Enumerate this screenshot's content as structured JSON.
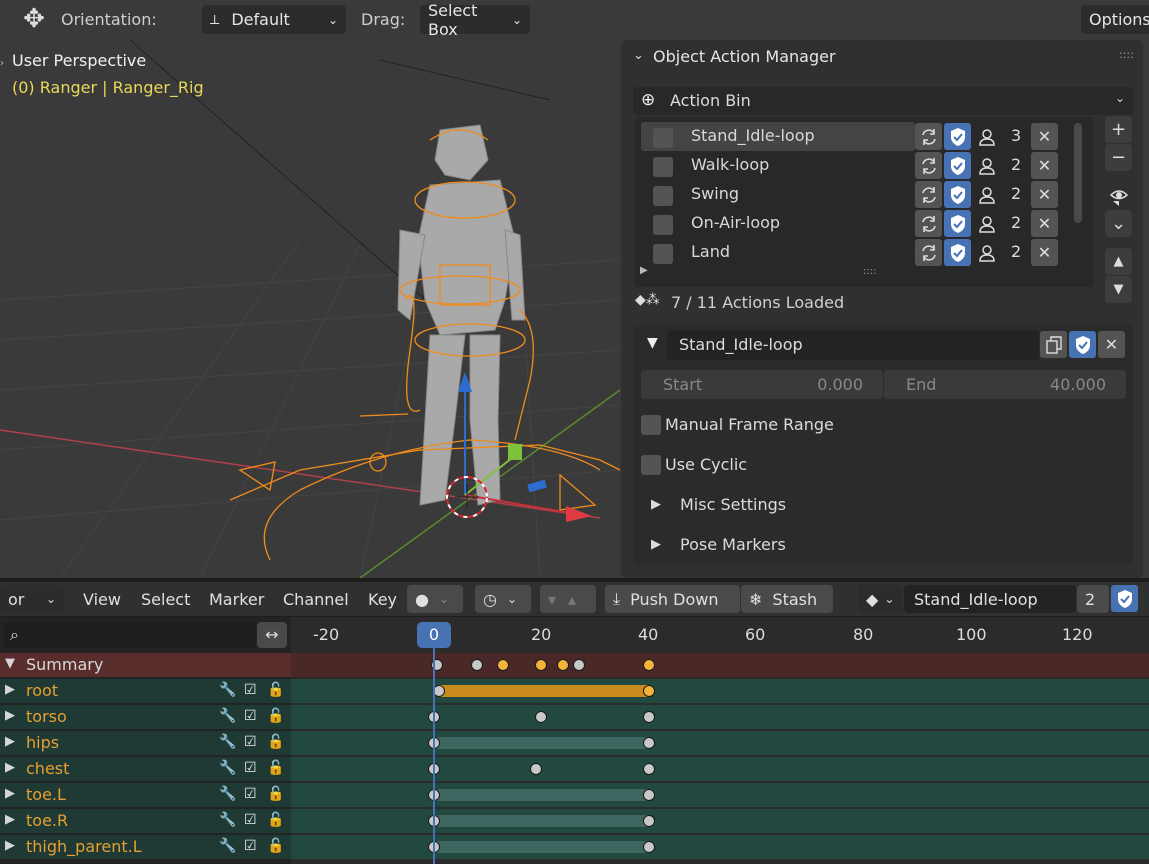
{
  "viewport": {
    "orientation_label": "Orientation:",
    "orientation_value": "Default",
    "drag_label": "Drag:",
    "drag_value": "Select Box",
    "options_label": "Options",
    "view_name": "User Perspective",
    "object_info": "(0) Ranger | Ranger_Rig"
  },
  "panel": {
    "title": "Object Action Manager",
    "action_bin_label": "Action Bin",
    "actions": [
      {
        "name": "Stand_Idle-loop",
        "users": "3",
        "selected": true
      },
      {
        "name": "Walk-loop",
        "users": "2",
        "selected": false
      },
      {
        "name": "Swing",
        "users": "2",
        "selected": false
      },
      {
        "name": "On-Air-loop",
        "users": "2",
        "selected": false
      },
      {
        "name": "Land",
        "users": "2",
        "selected": false
      }
    ],
    "actions_loaded": "7 / 11 Actions Loaded",
    "active_action": "Stand_Idle-loop",
    "start_label": "Start",
    "start_value": "0.000",
    "end_label": "End",
    "end_value": "40.000",
    "manual_frame_range": "Manual Frame Range",
    "use_cyclic": "Use Cyclic",
    "misc_settings": "Misc Settings",
    "pose_markers": "Pose Markers"
  },
  "timeline": {
    "mode_partial": "or",
    "menu": [
      "View",
      "Select",
      "Marker",
      "Channel",
      "Key"
    ],
    "push_down": "Push Down",
    "stash": "Stash",
    "action_name": "Stand_Idle-loop",
    "action_users": "2",
    "current_frame": "0",
    "frame_ticks": [
      "-20",
      "20",
      "40",
      "60",
      "80",
      "100",
      "120"
    ],
    "summary_label": "Summary",
    "channels": [
      "root",
      "torso",
      "hips",
      "chest",
      "toe.L",
      "toe.R",
      "thigh_parent.L"
    ],
    "colors": {
      "accent": "#4772b3",
      "key_selected": "#f4b43a",
      "summary_bg": "#5a2d2d",
      "channel_bg": "#1f3a35"
    }
  }
}
